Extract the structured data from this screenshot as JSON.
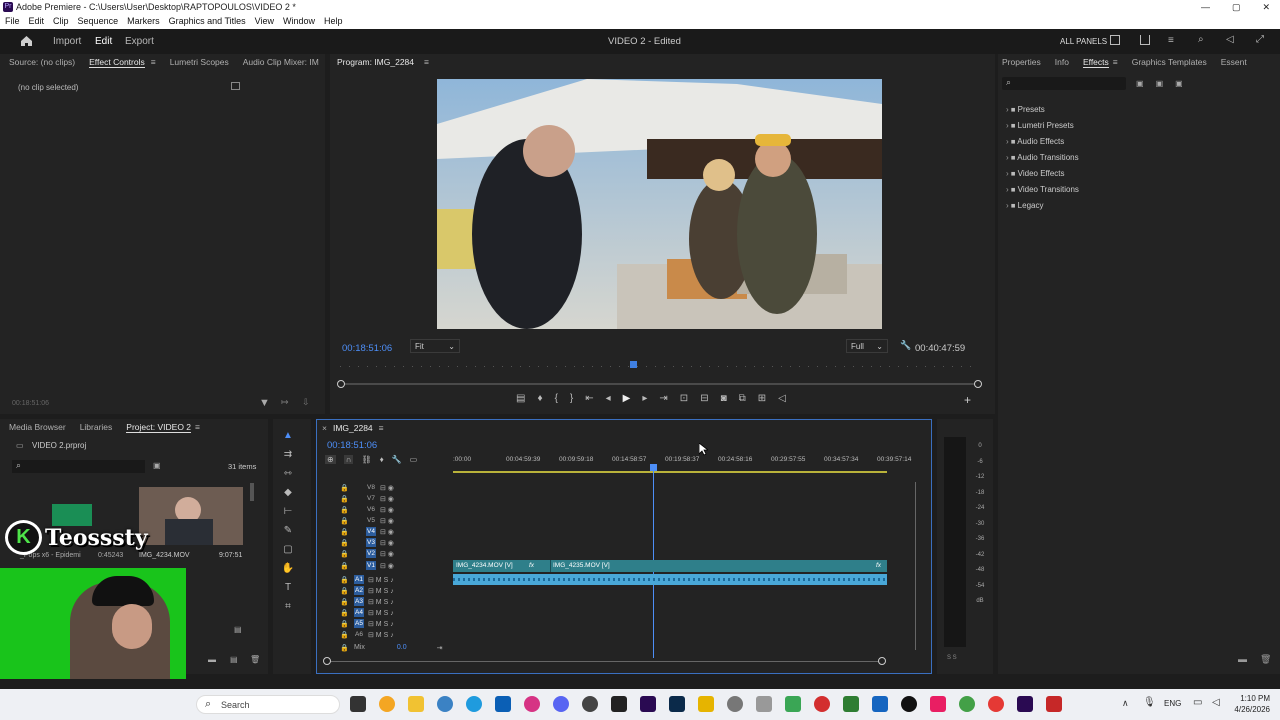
{
  "window": {
    "title": "Adobe Premiere - C:\\Users\\User\\Desktop\\RAPTOPOULOS\\VIDEO 2 *",
    "min": "—",
    "max": "▢",
    "close": "✕"
  },
  "menu": [
    "File",
    "Edit",
    "Clip",
    "Sequence",
    "Markers",
    "Graphics and Titles",
    "View",
    "Window",
    "Help"
  ],
  "topnav": {
    "import": "Import",
    "edit": "Edit",
    "export": "Export",
    "project_title": "VIDEO 2 - Edited",
    "all_panels": "ALL PANELS"
  },
  "source_panel": {
    "tabs": [
      "Source: (no clips)",
      "Effect Controls",
      "Lumetri Scopes",
      "Audio Clip Mixer: IM"
    ],
    "empty": "(no clip selected)",
    "timecode": "00:18:51:06"
  },
  "program": {
    "title": "Program: IMG_2284",
    "timecode": "00:18:51:06",
    "fit": "Fit",
    "quality": "Full",
    "duration": "00:40:47:59"
  },
  "effects_panel": {
    "tabs": [
      "Properties",
      "Info",
      "Effects",
      "Graphics Templates",
      "Essent"
    ],
    "folders": [
      "Presets",
      "Lumetri Presets",
      "Audio Effects",
      "Audio Transitions",
      "Video Effects",
      "Video Transitions",
      "Legacy"
    ]
  },
  "project": {
    "tabs": [
      "Media Browser",
      "Libraries",
      "Project: VIDEO 2"
    ],
    "file": "VIDEO 2.prproj",
    "items": "31 items",
    "clip1_name": "IMG_4234.MOV",
    "clip1_dur": "9:07:51",
    "clip0_name": "_Pops x6 - Epidemi",
    "clip0_dur": "0:45243"
  },
  "watermark": "Teosssty",
  "timeline": {
    "seq_name": "IMG_2284",
    "timecode": "00:18:51:06",
    "ruler": [
      ":00:00",
      "00:04:59:39",
      "00:09:59:18",
      "00:14:58:57",
      "00:19:58:37",
      "00:24:58:16",
      "00:29:57:55",
      "00:34:57:34",
      "00:39:57:14"
    ],
    "video_tracks": [
      "V8",
      "V7",
      "V6",
      "V5",
      "V4",
      "V3",
      "V2",
      "V1"
    ],
    "audio_tracks": [
      "A1",
      "A2",
      "A3",
      "A4",
      "A5",
      "A6"
    ],
    "mix_label": "Mix",
    "mix_value": "0.0",
    "clip_a": "IMG_4234.MOV [V]",
    "clip_b": "IMG_4235.MOV [V]",
    "fx": "fx"
  },
  "meter": {
    "labels": [
      "0",
      "-6",
      "-12",
      "-18",
      "-24",
      "-30",
      "-36",
      "-42",
      "-48",
      "-54",
      "dB"
    ],
    "solo": "S   S"
  },
  "taskbar": {
    "search": "Search",
    "lang": "ENG",
    "time": "1:10 PM",
    "date": "4/26/2026"
  }
}
